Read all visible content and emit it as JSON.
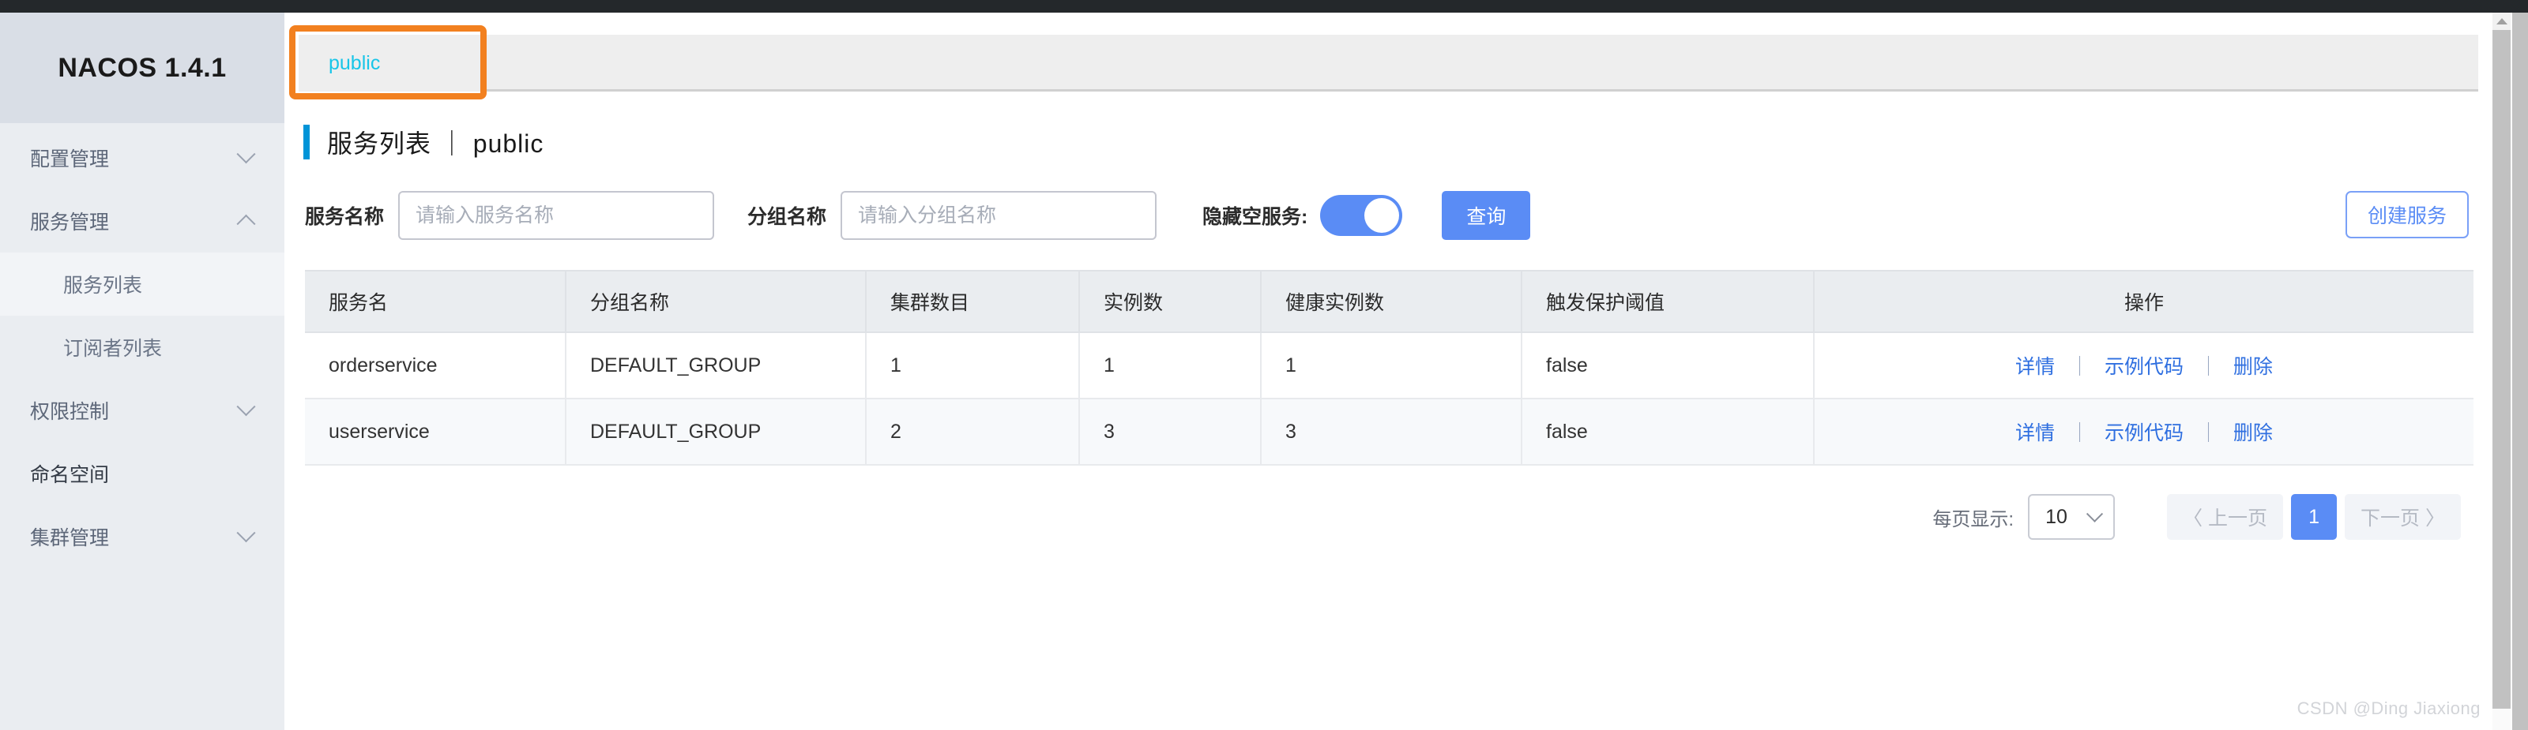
{
  "brand": {
    "title": "NACOS 1.4.1"
  },
  "sidebar": {
    "items": [
      {
        "label": "配置管理",
        "chevron": "chevron-down-icon"
      },
      {
        "label": "服务管理",
        "chevron": "chevron-up-icon"
      },
      {
        "label": "服务列表",
        "chevron": ""
      },
      {
        "label": "订阅者列表",
        "chevron": ""
      },
      {
        "label": "权限控制",
        "chevron": "chevron-down-icon"
      },
      {
        "label": "命名空间",
        "chevron": ""
      },
      {
        "label": "集群管理",
        "chevron": "chevron-down-icon"
      }
    ]
  },
  "tabs": {
    "active": "public"
  },
  "page": {
    "title": "服务列表 ｜ public"
  },
  "filters": {
    "service_name_label": "服务名称",
    "service_name_value": "",
    "service_name_placeholder": "请输入服务名称",
    "group_name_label": "分组名称",
    "group_name_value": "",
    "group_name_placeholder": "请输入分组名称",
    "hide_empty_label": "隐藏空服务:",
    "hide_empty_on": true,
    "query_button": "查询",
    "create_button": "创建服务"
  },
  "table": {
    "headers": [
      "服务名",
      "分组名称",
      "集群数目",
      "实例数",
      "健康实例数",
      "触发保护阈值",
      "操作"
    ],
    "actions": [
      "详情",
      "示例代码",
      "删除"
    ],
    "action_separator": "｜",
    "rows": [
      {
        "service": "orderservice",
        "group": "DEFAULT_GROUP",
        "clusters": "1",
        "instances": "1",
        "healthy": "1",
        "threshold": "false"
      },
      {
        "service": "userservice",
        "group": "DEFAULT_GROUP",
        "clusters": "2",
        "instances": "3",
        "healthy": "3",
        "threshold": "false"
      }
    ]
  },
  "pagination": {
    "page_size_label": "每页显示:",
    "page_size": "10",
    "prev": "〈 上一页",
    "current": "1",
    "next": "下一页 〉"
  },
  "watermark": "CSDN @Ding Jiaxiong",
  "colors": {
    "accent_blue": "#5a8cf5",
    "title_bar": "#0094d8",
    "tab_text": "#18c5e8",
    "annotation": "#f2801f",
    "link": "#2f6fe0"
  }
}
